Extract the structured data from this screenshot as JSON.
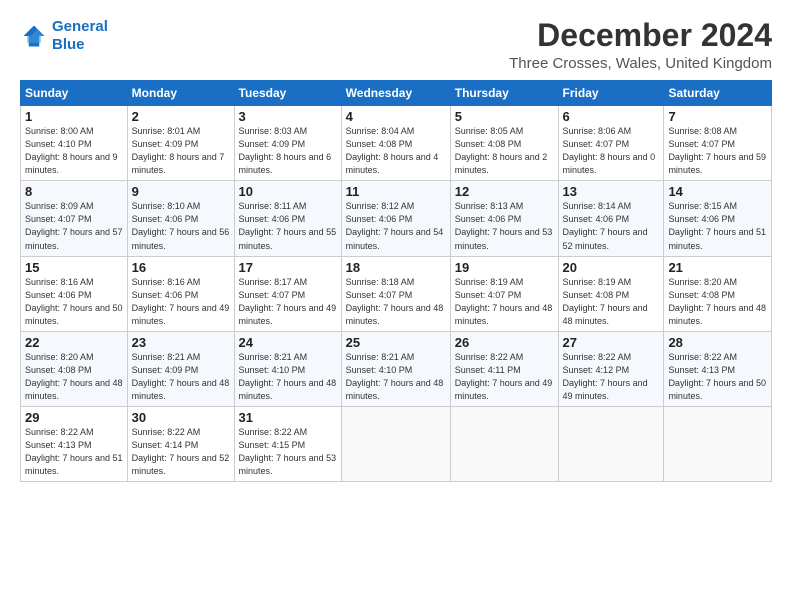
{
  "logo": {
    "line1": "General",
    "line2": "Blue"
  },
  "title": "December 2024",
  "location": "Three Crosses, Wales, United Kingdom",
  "days_of_week": [
    "Sunday",
    "Monday",
    "Tuesday",
    "Wednesday",
    "Thursday",
    "Friday",
    "Saturday"
  ],
  "weeks": [
    [
      {
        "day": "1",
        "sunrise": "8:00 AM",
        "sunset": "4:10 PM",
        "daylight": "8 hours and 9 minutes."
      },
      {
        "day": "2",
        "sunrise": "8:01 AM",
        "sunset": "4:09 PM",
        "daylight": "8 hours and 7 minutes."
      },
      {
        "day": "3",
        "sunrise": "8:03 AM",
        "sunset": "4:09 PM",
        "daylight": "8 hours and 6 minutes."
      },
      {
        "day": "4",
        "sunrise": "8:04 AM",
        "sunset": "4:08 PM",
        "daylight": "8 hours and 4 minutes."
      },
      {
        "day": "5",
        "sunrise": "8:05 AM",
        "sunset": "4:08 PM",
        "daylight": "8 hours and 2 minutes."
      },
      {
        "day": "6",
        "sunrise": "8:06 AM",
        "sunset": "4:07 PM",
        "daylight": "8 hours and 0 minutes."
      },
      {
        "day": "7",
        "sunrise": "8:08 AM",
        "sunset": "4:07 PM",
        "daylight": "7 hours and 59 minutes."
      }
    ],
    [
      {
        "day": "8",
        "sunrise": "8:09 AM",
        "sunset": "4:07 PM",
        "daylight": "7 hours and 57 minutes."
      },
      {
        "day": "9",
        "sunrise": "8:10 AM",
        "sunset": "4:06 PM",
        "daylight": "7 hours and 56 minutes."
      },
      {
        "day": "10",
        "sunrise": "8:11 AM",
        "sunset": "4:06 PM",
        "daylight": "7 hours and 55 minutes."
      },
      {
        "day": "11",
        "sunrise": "8:12 AM",
        "sunset": "4:06 PM",
        "daylight": "7 hours and 54 minutes."
      },
      {
        "day": "12",
        "sunrise": "8:13 AM",
        "sunset": "4:06 PM",
        "daylight": "7 hours and 53 minutes."
      },
      {
        "day": "13",
        "sunrise": "8:14 AM",
        "sunset": "4:06 PM",
        "daylight": "7 hours and 52 minutes."
      },
      {
        "day": "14",
        "sunrise": "8:15 AM",
        "sunset": "4:06 PM",
        "daylight": "7 hours and 51 minutes."
      }
    ],
    [
      {
        "day": "15",
        "sunrise": "8:16 AM",
        "sunset": "4:06 PM",
        "daylight": "7 hours and 50 minutes."
      },
      {
        "day": "16",
        "sunrise": "8:16 AM",
        "sunset": "4:06 PM",
        "daylight": "7 hours and 49 minutes."
      },
      {
        "day": "17",
        "sunrise": "8:17 AM",
        "sunset": "4:07 PM",
        "daylight": "7 hours and 49 minutes."
      },
      {
        "day": "18",
        "sunrise": "8:18 AM",
        "sunset": "4:07 PM",
        "daylight": "7 hours and 48 minutes."
      },
      {
        "day": "19",
        "sunrise": "8:19 AM",
        "sunset": "4:07 PM",
        "daylight": "7 hours and 48 minutes."
      },
      {
        "day": "20",
        "sunrise": "8:19 AM",
        "sunset": "4:08 PM",
        "daylight": "7 hours and 48 minutes."
      },
      {
        "day": "21",
        "sunrise": "8:20 AM",
        "sunset": "4:08 PM",
        "daylight": "7 hours and 48 minutes."
      }
    ],
    [
      {
        "day": "22",
        "sunrise": "8:20 AM",
        "sunset": "4:08 PM",
        "daylight": "7 hours and 48 minutes."
      },
      {
        "day": "23",
        "sunrise": "8:21 AM",
        "sunset": "4:09 PM",
        "daylight": "7 hours and 48 minutes."
      },
      {
        "day": "24",
        "sunrise": "8:21 AM",
        "sunset": "4:10 PM",
        "daylight": "7 hours and 48 minutes."
      },
      {
        "day": "25",
        "sunrise": "8:21 AM",
        "sunset": "4:10 PM",
        "daylight": "7 hours and 48 minutes."
      },
      {
        "day": "26",
        "sunrise": "8:22 AM",
        "sunset": "4:11 PM",
        "daylight": "7 hours and 49 minutes."
      },
      {
        "day": "27",
        "sunrise": "8:22 AM",
        "sunset": "4:12 PM",
        "daylight": "7 hours and 49 minutes."
      },
      {
        "day": "28",
        "sunrise": "8:22 AM",
        "sunset": "4:13 PM",
        "daylight": "7 hours and 50 minutes."
      }
    ],
    [
      {
        "day": "29",
        "sunrise": "8:22 AM",
        "sunset": "4:13 PM",
        "daylight": "7 hours and 51 minutes."
      },
      {
        "day": "30",
        "sunrise": "8:22 AM",
        "sunset": "4:14 PM",
        "daylight": "7 hours and 52 minutes."
      },
      {
        "day": "31",
        "sunrise": "8:22 AM",
        "sunset": "4:15 PM",
        "daylight": "7 hours and 53 minutes."
      },
      null,
      null,
      null,
      null
    ]
  ],
  "labels": {
    "sunrise": "Sunrise:",
    "sunset": "Sunset:",
    "daylight": "Daylight:"
  }
}
